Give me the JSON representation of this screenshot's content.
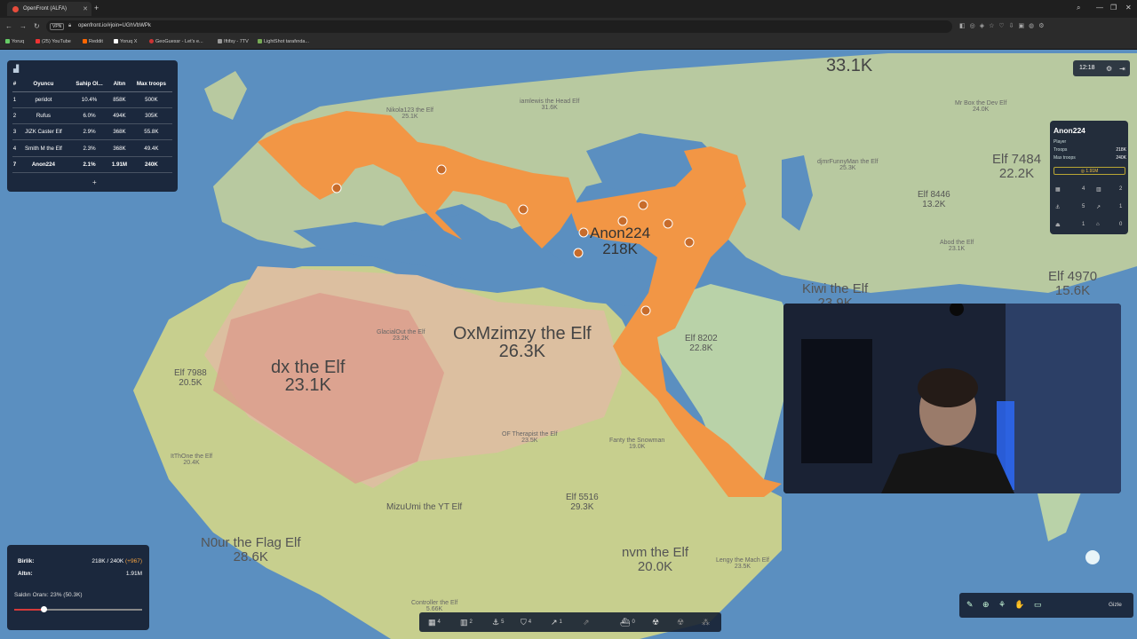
{
  "browser": {
    "tab_title": "OpenFront (ALFA)",
    "new_tab": "+",
    "url": "openfront.io/#join=UGhVbWPk",
    "vpn": "VPN",
    "bookmarks": [
      "Yoruq",
      "(25) YouTube",
      "Reddit",
      "Yoruq X",
      "GeoGuessr - Let's e...",
      "Iftifsy - 7TV",
      "LightShot tarafında..."
    ]
  },
  "leaderboard": {
    "headers": [
      "#",
      "Oyuncu",
      "Sahip Ol...",
      "Altın",
      "Max troops"
    ],
    "rows": [
      [
        "1",
        "peridot",
        "10.4%",
        "858K",
        "500K"
      ],
      [
        "2",
        "Rufus",
        "6.0%",
        "494K",
        "305K"
      ],
      [
        "3",
        "JIZK Caster Elf",
        "2.9%",
        "368K",
        "55.8K"
      ],
      [
        "4",
        "Smith M the Elf",
        "2.3%",
        "368K",
        "49.4K"
      ],
      [
        "7",
        "Anon224",
        "2.1%",
        "1.91M",
        "240K"
      ]
    ],
    "expand": "+"
  },
  "top_right": {
    "time": "12:18"
  },
  "player_panel": {
    "name": "Anon224",
    "role": "Player",
    "troops_label": "Troops",
    "troops_value": "218K",
    "max_troops_label": "Max troops",
    "max_troops_value": "240K",
    "gold": "1.91M",
    "rows": [
      [
        "4",
        "2"
      ],
      [
        "5",
        "1"
      ],
      [
        "1",
        "0"
      ]
    ]
  },
  "bottom_left": {
    "troops_label": "Birlik:",
    "troops_value": "218K / 240K",
    "troops_plus": "(+967)",
    "gold_label": "Altın:",
    "gold_value": "1.91M",
    "attack_ratio": "Saldırı Oranı: 23% (50.3K)",
    "attack_ratio_pct": 23
  },
  "bottom_bar": {
    "items": [
      "4",
      "2",
      "5",
      "4",
      "1",
      "",
      "0",
      "",
      ""
    ]
  },
  "bottom_right": {
    "hide": "Gizle"
  },
  "map_labels": {
    "top_count": "33.1K",
    "anon_name": "Anon224",
    "anon_troops": "218K",
    "ox_name": "OxMzimzy the Elf",
    "ox_troops": "26.3K",
    "dx_name": "dx the Elf",
    "dx_troops": "23.1K",
    "kiwi_name": "Kiwi the Elf",
    "kiwi_troops": "23.9K",
    "elf7484_name": "Elf 7484",
    "elf7484_troops": "22.2K",
    "elf4970_name": "Elf 4970",
    "elf4970_troops": "15.6K",
    "elf8446_name": "Elf 8446",
    "elf8446_troops": "13.2K",
    "elf8202_name": "Elf 8202",
    "elf8202_troops": "22.8K",
    "elf7988_name": "Elf 7988",
    "elf7988_troops": "20.5K",
    "elf5516_name": "Elf 5516",
    "elf5516_troops": "29.3K",
    "nvm_name": "nvm the Elf",
    "nvm_troops": "20.0K",
    "mizu_name": "MizuUmi the YT Elf",
    "mizu_troops": "",
    "n0ur_name": "N0ur the Flag Elf",
    "n0ur_troops": "28.6K",
    "jamlewis_name": "iamlewis the Head Elf",
    "jamlewis_troops": "31.6K",
    "nikola_name": "Nikola123 the Elf",
    "nikola_troops": "25.1K",
    "mrbox_name": "Mr Box the Dev Elf",
    "mrbox_troops": "24.0K",
    "djmr_name": "djmrFunnyMan the Elf",
    "djmr_troops": "25.3K",
    "abod_name": "Abod the Elf",
    "abod_troops": "23.1K",
    "glacial_name": "GlacialOut the Elf",
    "glacial_troops": "23.2K",
    "ofther_name": "OF Therapist the Elf",
    "ofther_troops": "23.5K",
    "fanty_name": "Fanty the Snowman",
    "fanty_troops": "19.0K",
    "ithone_name": "ItThOne the Elf",
    "ithone_troops": "20.4K",
    "controller_name": "Controller the Elf",
    "controller_troops": "5.66K",
    "leng_name": "Lengy the Mach Elf",
    "leng_troops": "23.5K"
  }
}
